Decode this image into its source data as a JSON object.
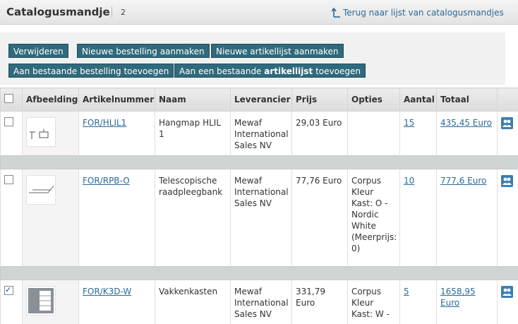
{
  "header": {
    "title": "Catalogusmandje",
    "count": "2",
    "back_link": "Terug naar lijst van catalogusmandjes"
  },
  "toolbar": {
    "delete": "Verwijderen",
    "new_order": "Nieuwe bestelling aanmaken",
    "new_list": "Nieuwe artikellijst aanmaken",
    "add_existing_order": "Aan bestaande bestelling toevoegen",
    "add_list_prefix": "Aan een bestaande",
    "add_list_bold": "artikellijst",
    "add_list_suffix": "toevoegen"
  },
  "table": {
    "columns": [
      "",
      "Afbeelding",
      "Artikelnummer",
      "Naam",
      "Leverancier",
      "Prijs",
      "Opties",
      "Aantal",
      "Totaal",
      ""
    ],
    "rows": [
      {
        "checked": false,
        "article": "FOR/HLIL1",
        "name": "Hangmap HLIL 1",
        "supplier": "Mewaf International Sales NV",
        "price": "29,03 Euro",
        "options": "",
        "quantity": "15",
        "total": "435,45 Euro"
      },
      {
        "checked": false,
        "article": "FOR/RPB-O",
        "name": "Telescopische raadpleegbank",
        "supplier": "Mewaf International Sales NV",
        "price": "77,76 Euro",
        "options": "Corpus Kleur Kast: O - Nordic White (Meerprijs: 0)",
        "quantity": "10",
        "total": "777,6 Euro"
      },
      {
        "checked": true,
        "article": "FOR/K3D-W",
        "name": "Vakkenkasten",
        "supplier": "Mewaf International Sales NV",
        "price": "331,79 Euro",
        "options": "Corpus Kleur Kast: W -",
        "quantity": "5",
        "total": "1658,95 Euro"
      }
    ]
  }
}
